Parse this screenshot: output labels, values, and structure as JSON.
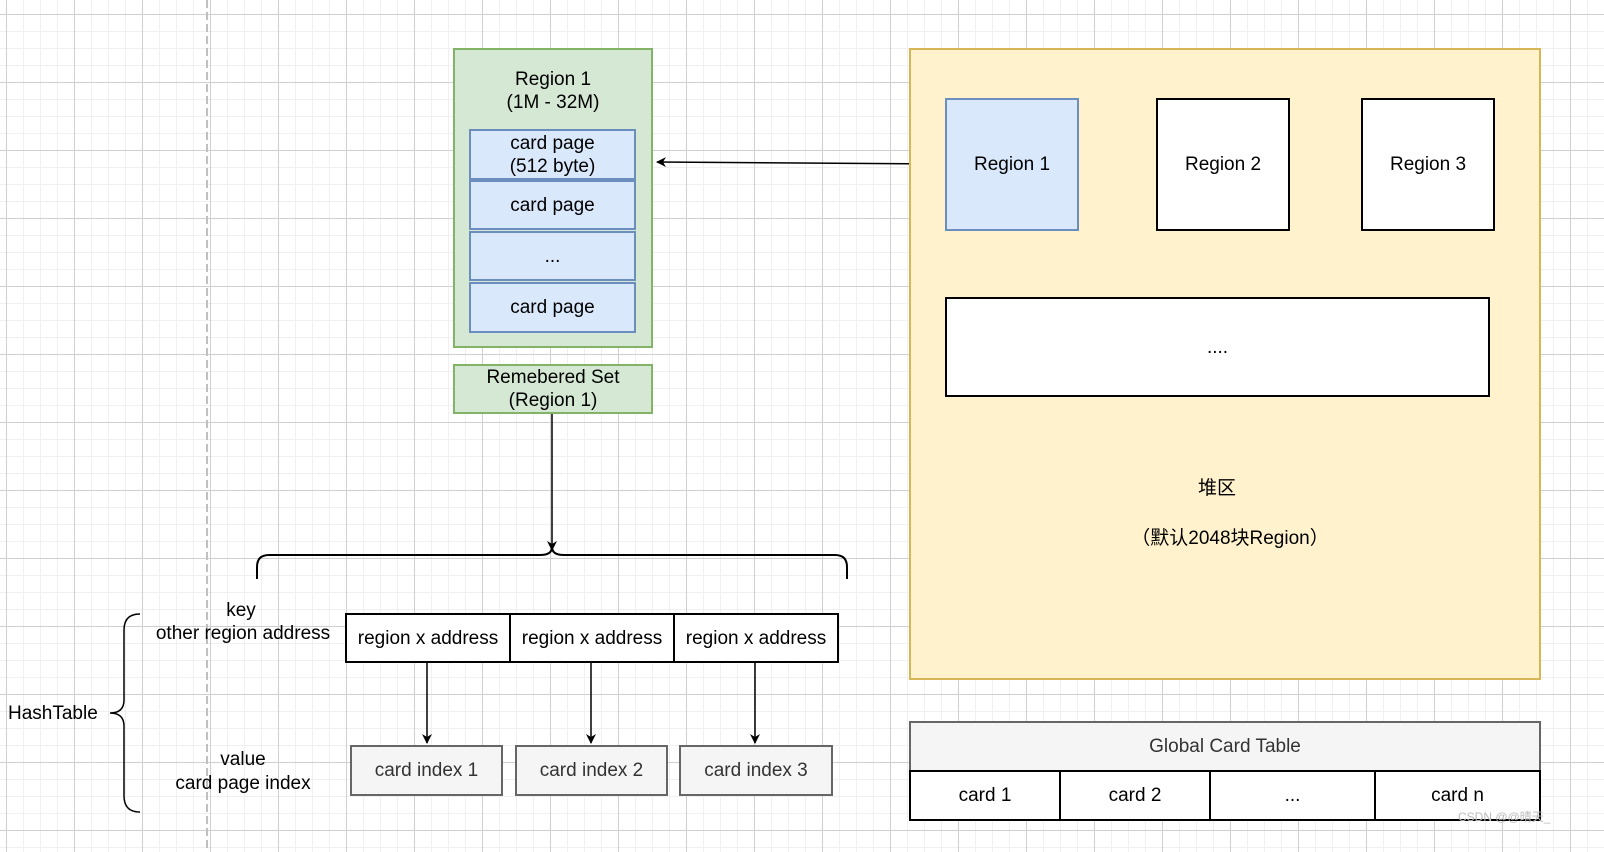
{
  "region_detail": {
    "title": "Region 1",
    "size": "(1M - 32M)",
    "card_pages": [
      "card page\n(512 byte)",
      "card page",
      "...",
      "card page"
    ],
    "card_page_first_line": "card page",
    "card_page_first_size": "(512 byte)"
  },
  "remembered_set": {
    "line1": "Remebered Set",
    "line2": "(Region 1)"
  },
  "heap": {
    "regions": [
      "Region 1",
      "Region 2",
      "Region 3"
    ],
    "more": "....",
    "title": "堆区",
    "subtitle": "（默认2048块Region）"
  },
  "global_card_table": {
    "title": "Global Card Table",
    "cards": [
      "card 1",
      "card 2",
      "...",
      "card n"
    ]
  },
  "hashtable": {
    "label": "HashTable",
    "key_label": "key",
    "key_desc": "other region address",
    "value_label": "value",
    "value_desc": "card page index",
    "keys": [
      "region x address",
      "region x address",
      "region x address"
    ],
    "values": [
      "card index 1",
      "card index 2",
      "card index 3"
    ]
  },
  "watermark": "CSDN @@晴天_",
  "colors": {
    "green": "#d5e8d4",
    "blue": "#dae8fc",
    "yellow": "#fff2cc",
    "gray": "#f5f5f5"
  }
}
